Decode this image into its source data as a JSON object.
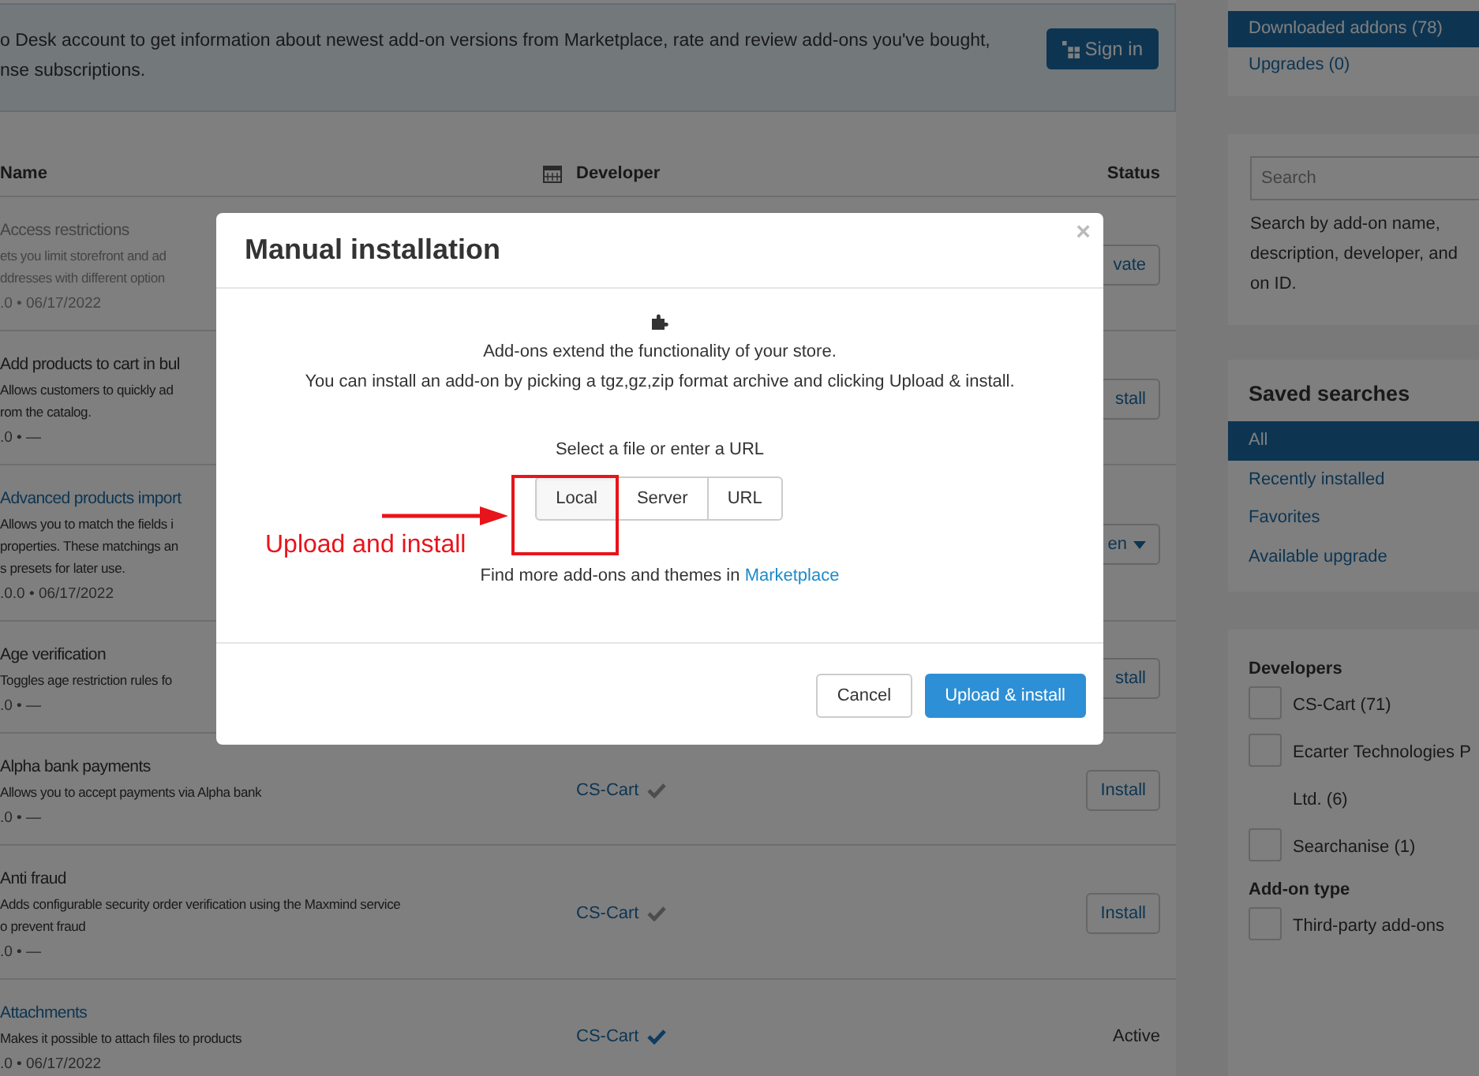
{
  "banner": {
    "lines": [
      "o Desk account to get information about newest add-on versions from Marketplace, rate and review add-ons you've bought,",
      "nse subscriptions."
    ],
    "button": "Sign in"
  },
  "table": {
    "columns": [
      "Name",
      "Developer",
      "Status"
    ],
    "rows": [
      {
        "name": "Access restrictions",
        "disabled": true,
        "linked": false,
        "description": [
          "ets you limit storefront and ad",
          "ddresses with different option"
        ],
        "meta": ".0 • 06/17/2022",
        "status": {
          "kind": "button",
          "label": "vate"
        }
      },
      {
        "name": "Add products to cart in bul",
        "disabled": false,
        "linked": false,
        "description": [
          "Allows customers to quickly ad",
          "rom the catalog."
        ],
        "meta": ".0 • —",
        "status": {
          "kind": "button",
          "label": "stall"
        }
      },
      {
        "name": "Advanced products import",
        "disabled": false,
        "linked": true,
        "description": [
          "Allows you to match the fields i",
          "properties. These matchings an",
          "s presets for later use."
        ],
        "meta": ".0.0 • 06/17/2022",
        "status": {
          "kind": "dropdown",
          "label": "en"
        }
      },
      {
        "name": "Age verification",
        "disabled": false,
        "linked": false,
        "description": [
          "Toggles age restriction rules fo"
        ],
        "meta": ".0 • —",
        "status": {
          "kind": "button",
          "label": "stall"
        }
      },
      {
        "name": "Alpha bank payments",
        "disabled": false,
        "linked": false,
        "description": [
          "Allows you to accept payments via Alpha bank"
        ],
        "meta": ".0 • —",
        "developer": {
          "name": "CS-Cart",
          "highlighted": false
        },
        "status": {
          "kind": "button",
          "label": "Install"
        }
      },
      {
        "name": "Anti fraud",
        "disabled": false,
        "linked": false,
        "description": [
          "Adds configurable security order verification using the Maxmind service",
          "o prevent fraud"
        ],
        "meta": ".0 • —",
        "developer": {
          "name": "CS-Cart",
          "highlighted": false
        },
        "status": {
          "kind": "button",
          "label": "Install"
        }
      },
      {
        "name": "Attachments",
        "disabled": false,
        "linked": true,
        "description": [
          "Makes it possible to attach files to products"
        ],
        "meta": ".0 • 06/17/2022",
        "developer": {
          "name": "CS-Cart",
          "highlighted": true
        },
        "status": {
          "kind": "text",
          "label": "Active"
        }
      }
    ]
  },
  "sidebar": {
    "views": [
      {
        "label": "Downloaded addons (78)",
        "selected": true
      },
      {
        "label": "Upgrades (0)",
        "selected": false
      }
    ],
    "search": {
      "placeholder": "Search",
      "help": [
        "Search by add-on name,",
        "description, developer, and",
        "on ID."
      ]
    },
    "saved_searches": {
      "title": "Saved searches",
      "items": [
        {
          "label": "All",
          "selected": true
        },
        {
          "label": "Recently installed",
          "selected": false
        },
        {
          "label": "Favorites",
          "selected": false
        },
        {
          "label": "Available upgrade",
          "selected": false
        }
      ]
    },
    "filters": [
      {
        "title": "Developers",
        "options": [
          {
            "lines": [
              "CS-Cart (71)"
            ],
            "checked": false
          },
          {
            "lines": [
              "Ecarter Technologies P",
              "Ltd. (6)"
            ],
            "checked": false
          },
          {
            "lines": [
              "Searchanise (1)"
            ],
            "checked": false
          }
        ]
      },
      {
        "title": "Add-on type",
        "options": [
          {
            "lines": [
              "Third-party add-ons"
            ],
            "checked": false
          }
        ]
      }
    ]
  },
  "modal": {
    "title": "Manual installation",
    "close": "×",
    "intro": [
      "Add-ons extend the functionality of your store.",
      "You can install an add-on by picking a tgz,gz,zip format archive and clicking Upload & install."
    ],
    "select_label": "Select a file or enter a URL",
    "sources": [
      {
        "label": "Local",
        "selected": true
      },
      {
        "label": "Server",
        "selected": false
      },
      {
        "label": "URL",
        "selected": false
      }
    ],
    "more_text": "Find more add-ons and themes in",
    "more_link": "Marketplace",
    "annotation": "Upload and install",
    "buttons": [
      {
        "label": "Cancel",
        "kind": "default"
      },
      {
        "label": "Upload & install",
        "kind": "primary"
      }
    ]
  }
}
